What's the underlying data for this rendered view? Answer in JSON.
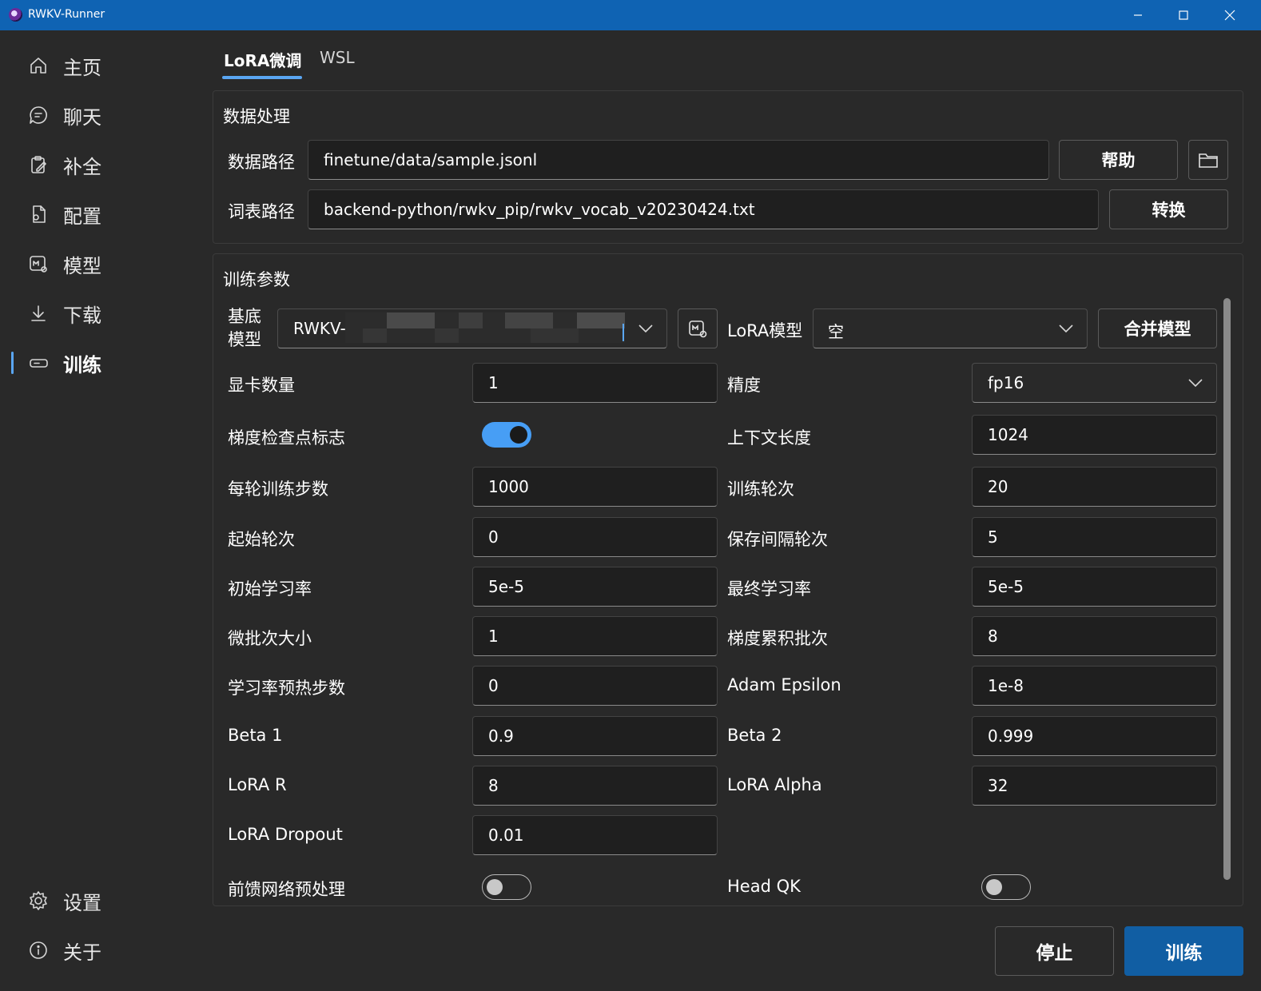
{
  "window": {
    "title": "RWKV-Runner",
    "minimize_icon": "minimize-icon",
    "maximize_icon": "maximize-icon",
    "close_icon": "close-icon"
  },
  "sidebar": {
    "items": [
      {
        "label": "主页",
        "icon": "home-icon"
      },
      {
        "label": "聊天",
        "icon": "chat-icon"
      },
      {
        "label": "补全",
        "icon": "clipboard-edit-icon"
      },
      {
        "label": "配置",
        "icon": "document-settings-icon"
      },
      {
        "label": "模型",
        "icon": "model-icon"
      },
      {
        "label": "下载",
        "icon": "download-icon"
      },
      {
        "label": "训练",
        "icon": "training-icon",
        "active": true
      }
    ],
    "bottom_items": [
      {
        "label": "设置",
        "icon": "gear-icon"
      },
      {
        "label": "关于",
        "icon": "info-icon"
      }
    ]
  },
  "tabs": [
    {
      "label": "LoRA微调",
      "active": true
    },
    {
      "label": "WSL",
      "active": false
    }
  ],
  "data_processing": {
    "title": "数据处理",
    "data_path_label": "数据路径",
    "data_path_value": "finetune/data/sample.jsonl",
    "help_button": "帮助",
    "folder_icon": "folder-icon",
    "vocab_path_label": "词表路径",
    "vocab_path_value": "backend-python/rwkv_pip/rwkv_vocab_v20230424.txt",
    "convert_button": "转换"
  },
  "training_params": {
    "title": "训练参数",
    "base_model_label": "基底\n模型",
    "base_model_value": "RWKV-",
    "base_model_settings_icon": "model-settings-icon",
    "lora_model_label": "LoRA模型",
    "lora_model_value": "空",
    "merge_button": "合并模型",
    "fields": {
      "gpu_count": {
        "label": "显卡数量",
        "value": "1"
      },
      "precision": {
        "label": "精度",
        "value": "fp16"
      },
      "grad_cp": {
        "label": "梯度检查点标志",
        "on": true
      },
      "ctx_len": {
        "label": "上下文长度",
        "value": "1024"
      },
      "epoch_steps": {
        "label": "每轮训练步数",
        "value": "1000"
      },
      "epoch_count": {
        "label": "训练轮次",
        "value": "20"
      },
      "epoch_begin": {
        "label": "起始轮次",
        "value": "0"
      },
      "epoch_save": {
        "label": "保存间隔轮次",
        "value": "5"
      },
      "lr_init": {
        "label": "初始学习率",
        "value": "5e-5"
      },
      "lr_final": {
        "label": "最终学习率",
        "value": "5e-5"
      },
      "micro_bsz": {
        "label": "微批次大小",
        "value": "1"
      },
      "accumulate_grad_batches": {
        "label": "梯度累积批次",
        "value": "8"
      },
      "warmup_steps": {
        "label": "学习率预热步数",
        "value": "0"
      },
      "adam_eps": {
        "label": "Adam Epsilon",
        "value": "1e-8"
      },
      "beta1": {
        "label": "Beta 1",
        "value": "0.9"
      },
      "beta2": {
        "label": "Beta 2",
        "value": "0.999"
      },
      "lora_r": {
        "label": "LoRA R",
        "value": "8"
      },
      "lora_alpha": {
        "label": "LoRA Alpha",
        "value": "32"
      },
      "lora_dropout": {
        "label": "LoRA Dropout",
        "value": "0.01"
      },
      "pre_ffn": {
        "label": "前馈网络预处理",
        "on": false
      },
      "head_qk": {
        "label": "Head QK",
        "on": false
      }
    }
  },
  "actions": {
    "stop_button": "停止",
    "train_button": "训练"
  },
  "colors": {
    "titlebar": "#0f63b3",
    "accent": "#479ef5",
    "primary_button": "#115ea3",
    "background": "#292929"
  }
}
